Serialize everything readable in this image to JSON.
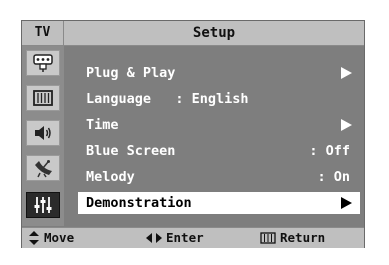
{
  "header": {
    "tv_label": "TV",
    "title": "Setup"
  },
  "sidebar": {
    "icons": [
      {
        "name": "input-icon"
      },
      {
        "name": "picture-icon"
      },
      {
        "name": "sound-icon"
      },
      {
        "name": "channel-icon"
      },
      {
        "name": "setup-icon",
        "active": true
      }
    ]
  },
  "menu": {
    "items": [
      {
        "label": "Plug & Play",
        "value": "",
        "has_submenu": true
      },
      {
        "label": "Language   : English",
        "value": "",
        "has_submenu": false
      },
      {
        "label": "Time",
        "value": "",
        "has_submenu": true
      },
      {
        "label": "Blue Screen",
        "value": ": Off",
        "has_submenu": false
      },
      {
        "label": "Melody",
        "value": ": On",
        "has_submenu": false
      },
      {
        "label": "Demonstration",
        "value": "",
        "has_submenu": true,
        "selected": true
      }
    ]
  },
  "footer": {
    "move_label": "Move",
    "enter_label": "Enter",
    "return_label": "Return"
  }
}
